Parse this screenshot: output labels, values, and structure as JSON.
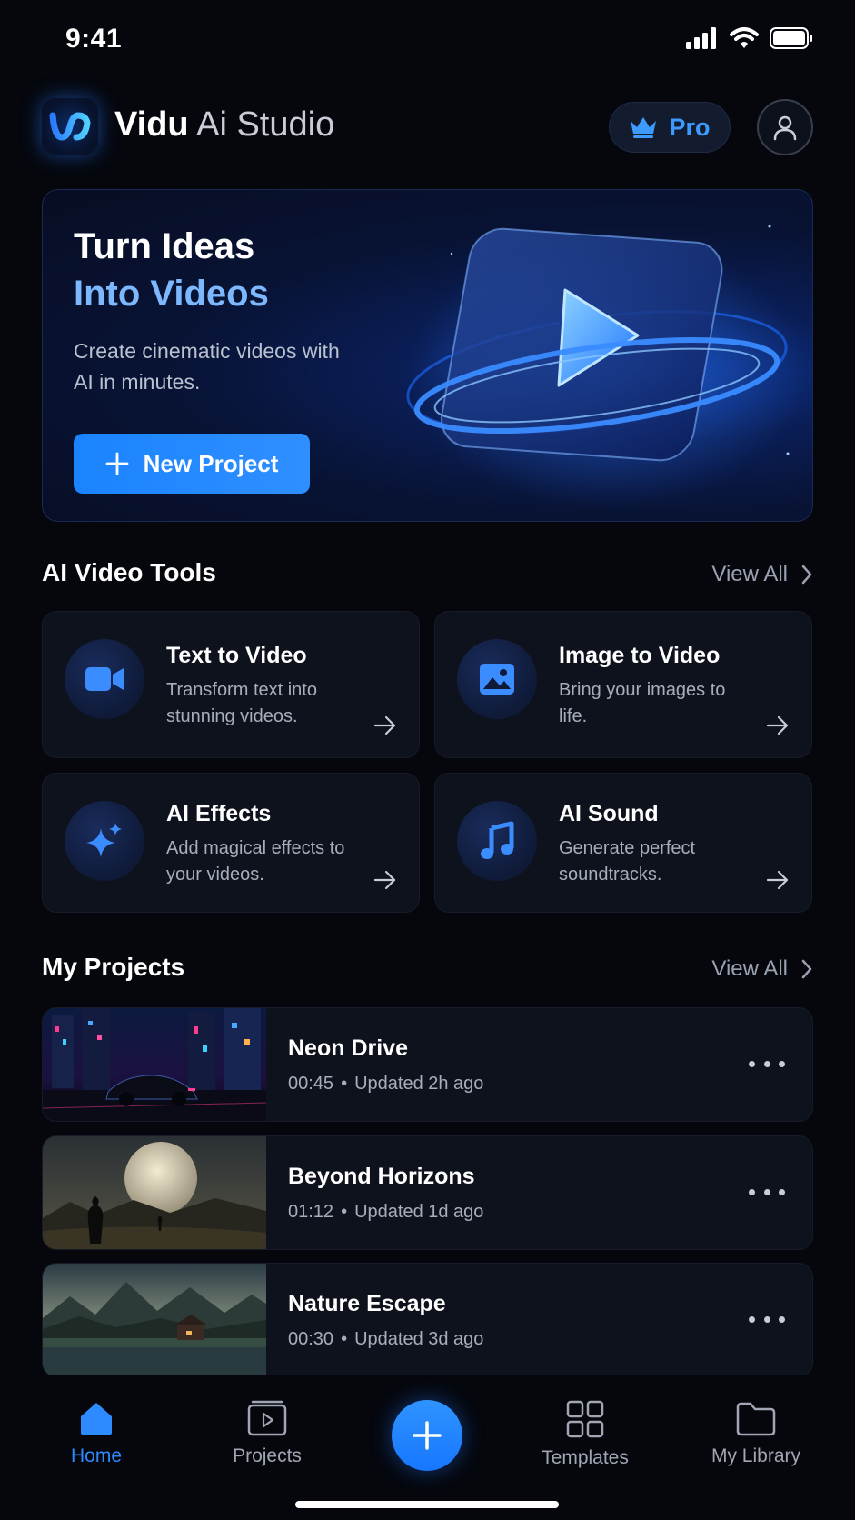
{
  "status_bar": {
    "time": "9:41"
  },
  "header": {
    "title_bold": "Vidu",
    "title_light": "Ai Studio",
    "pro_label": "Pro"
  },
  "hero": {
    "title_line1": "Turn Ideas",
    "title_line2": "Into Videos",
    "subtitle": "Create cinematic videos with AI in minutes.",
    "button_label": "New Project"
  },
  "tools_section": {
    "title": "AI Video Tools",
    "view_all": "View All",
    "items": [
      {
        "title": "Text to Video",
        "desc": "Transform text into stunning videos.",
        "icon": "video-camera-icon"
      },
      {
        "title": "Image to Video",
        "desc": "Bring your images to life.",
        "icon": "image-icon"
      },
      {
        "title": "AI Effects",
        "desc": "Add magical effects to your videos.",
        "icon": "sparkle-icon"
      },
      {
        "title": "AI Sound",
        "desc": "Generate perfect soundtracks.",
        "icon": "music-note-icon"
      }
    ]
  },
  "projects_section": {
    "title": "My Projects",
    "view_all": "View All",
    "items": [
      {
        "title": "Neon Drive",
        "duration": "00:45",
        "updated": "Updated 2h ago"
      },
      {
        "title": "Beyond Horizons",
        "duration": "01:12",
        "updated": "Updated 1d ago"
      },
      {
        "title": "Nature Escape",
        "duration": "00:30",
        "updated": "Updated 3d ago"
      }
    ]
  },
  "bottom_nav": {
    "items": [
      {
        "label": "Home",
        "active": true
      },
      {
        "label": "Projects",
        "active": false
      },
      {
        "label": "Templates",
        "active": false
      },
      {
        "label": "My Library",
        "active": false
      }
    ]
  },
  "colors": {
    "accent": "#2d8bff",
    "background": "#05070d",
    "card": "#0e121c",
    "pro_text": "#3d9bff",
    "hero_highlight": "#7db8ff"
  }
}
